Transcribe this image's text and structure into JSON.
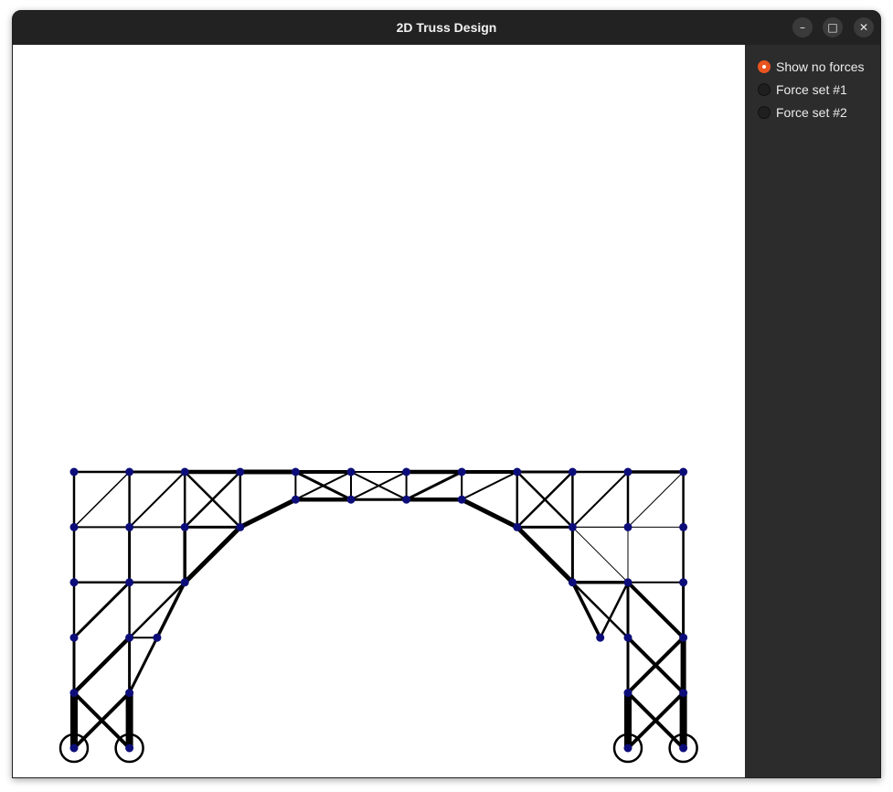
{
  "window": {
    "title": "2D Truss Design",
    "controls": [
      "minimize-icon",
      "maximize-icon",
      "close-icon"
    ]
  },
  "sidebar": {
    "options": [
      {
        "label": "Show no forces",
        "selected": true
      },
      {
        "label": "Force set #1",
        "selected": false
      },
      {
        "label": "Force set #2",
        "selected": false
      }
    ]
  },
  "colors": {
    "accent": "#e95420",
    "node": "#0d0d7a",
    "member": "#000000",
    "canvas": "#ffffff",
    "panel": "#2c2c2c",
    "titlebar": "#222222"
  },
  "truss": {
    "nodes": [
      [
        0,
        0
      ],
      [
        1,
        0
      ],
      [
        10,
        0
      ],
      [
        11,
        0
      ],
      [
        0,
        1
      ],
      [
        1,
        1
      ],
      [
        10,
        1
      ],
      [
        11,
        1
      ],
      [
        0,
        2
      ],
      [
        1,
        2
      ],
      [
        1.5,
        2
      ],
      [
        9.5,
        2
      ],
      [
        10,
        2
      ],
      [
        11,
        2
      ],
      [
        0,
        3
      ],
      [
        1,
        3
      ],
      [
        2,
        3
      ],
      [
        9,
        3
      ],
      [
        10,
        3
      ],
      [
        11,
        3
      ],
      [
        0,
        4
      ],
      [
        1,
        4
      ],
      [
        2,
        4
      ],
      [
        3,
        4
      ],
      [
        8,
        4
      ],
      [
        9,
        4
      ],
      [
        10,
        4
      ],
      [
        11,
        4
      ],
      [
        4,
        4.5
      ],
      [
        5,
        4.5
      ],
      [
        6,
        4.5
      ],
      [
        7,
        4.5
      ],
      [
        0,
        5
      ],
      [
        1,
        5
      ],
      [
        2,
        5
      ],
      [
        3,
        5
      ],
      [
        4,
        5
      ],
      [
        5,
        5
      ],
      [
        6,
        5
      ],
      [
        7,
        5
      ],
      [
        8,
        5
      ],
      [
        9,
        5
      ],
      [
        10,
        5
      ],
      [
        11,
        5
      ]
    ],
    "members": [
      [
        0,
        4,
        8
      ],
      [
        1,
        5,
        8
      ],
      [
        2,
        6,
        8
      ],
      [
        3,
        7,
        8
      ],
      [
        0,
        5,
        4
      ],
      [
        1,
        4,
        4
      ],
      [
        2,
        7,
        4
      ],
      [
        3,
        6,
        4
      ],
      [
        4,
        8,
        3
      ],
      [
        5,
        9,
        3
      ],
      [
        6,
        12,
        3
      ],
      [
        7,
        13,
        6
      ],
      [
        4,
        9,
        4.5
      ],
      [
        5,
        10,
        3
      ],
      [
        6,
        13,
        4
      ],
      [
        7,
        12,
        4
      ],
      [
        8,
        14,
        2.5
      ],
      [
        9,
        15,
        2.5
      ],
      [
        12,
        18,
        3
      ],
      [
        13,
        19,
        3
      ],
      [
        8,
        15,
        3
      ],
      [
        9,
        10,
        2
      ],
      [
        10,
        16,
        3.5
      ],
      [
        9,
        16,
        2.5
      ],
      [
        11,
        18,
        2.5
      ],
      [
        11,
        17,
        3.5
      ],
      [
        12,
        17,
        2.5
      ],
      [
        13,
        18,
        4
      ],
      [
        14,
        20,
        2.5
      ],
      [
        15,
        21,
        3
      ],
      [
        16,
        22,
        3.5
      ],
      [
        17,
        25,
        3
      ],
      [
        18,
        26,
        1
      ],
      [
        19,
        27,
        2.5
      ],
      [
        14,
        15,
        2.5
      ],
      [
        15,
        16,
        2.5
      ],
      [
        17,
        18,
        3.5
      ],
      [
        18,
        19,
        2
      ],
      [
        16,
        23,
        5
      ],
      [
        17,
        24,
        5
      ],
      [
        18,
        25,
        1
      ],
      [
        25,
        26,
        1
      ],
      [
        20,
        21,
        2
      ],
      [
        21,
        22,
        2
      ],
      [
        22,
        23,
        3
      ],
      [
        24,
        25,
        3
      ],
      [
        25,
        26,
        1
      ],
      [
        26,
        27,
        1
      ],
      [
        20,
        32,
        2.5
      ],
      [
        21,
        33,
        2.5
      ],
      [
        22,
        34,
        2.5
      ],
      [
        23,
        35,
        2.5
      ],
      [
        24,
        40,
        2.5
      ],
      [
        25,
        41,
        2.5
      ],
      [
        26,
        42,
        2.5
      ],
      [
        27,
        43,
        2.5
      ],
      [
        20,
        33,
        1.5
      ],
      [
        21,
        34,
        2
      ],
      [
        22,
        35,
        2.5
      ],
      [
        23,
        34,
        2.5
      ],
      [
        24,
        41,
        2.5
      ],
      [
        25,
        40,
        2.5
      ],
      [
        25,
        42,
        2
      ],
      [
        26,
        43,
        1
      ],
      [
        23,
        28,
        5
      ],
      [
        28,
        29,
        4.5
      ],
      [
        28,
        37,
        2
      ],
      [
        29,
        36,
        3
      ],
      [
        29,
        38,
        2
      ],
      [
        28,
        36,
        2
      ],
      [
        24,
        31,
        5
      ],
      [
        31,
        30,
        4.5
      ],
      [
        31,
        40,
        2
      ],
      [
        30,
        39,
        3
      ],
      [
        30,
        37,
        2
      ],
      [
        31,
        39,
        2
      ],
      [
        32,
        33,
        2.5
      ],
      [
        33,
        34,
        3
      ],
      [
        34,
        35,
        4.5
      ],
      [
        35,
        36,
        5
      ],
      [
        36,
        37,
        4
      ],
      [
        37,
        38,
        2
      ],
      [
        38,
        39,
        4.5
      ],
      [
        39,
        40,
        4
      ],
      [
        40,
        41,
        3
      ],
      [
        41,
        42,
        2.5
      ],
      [
        42,
        43,
        3.5
      ],
      [
        29,
        37,
        2
      ],
      [
        30,
        38,
        2
      ],
      [
        29,
        30,
        3
      ]
    ],
    "supports": [
      0,
      1,
      2,
      3
    ]
  }
}
